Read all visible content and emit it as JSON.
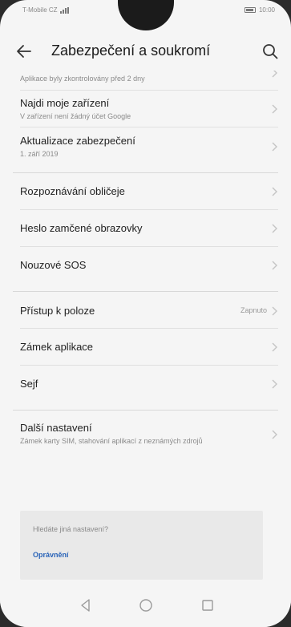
{
  "status_bar": {
    "carrier": "T-Mobile CZ",
    "time": "10:00"
  },
  "header": {
    "title": "Zabezpečení a soukromí"
  },
  "items": [
    {
      "title": "",
      "subtitle": "Aplikace byly zkontrolovány před 2 dny"
    },
    {
      "title": "Najdi moje zařízení",
      "subtitle": "V zařízení není žádný účet Google"
    },
    {
      "title": "Aktualizace zabezpečení",
      "subtitle": "1. září 2019"
    },
    {
      "title": "Rozpoznávání obličeje"
    },
    {
      "title": "Heslo zamčené obrazovky"
    },
    {
      "title": "Nouzové SOS"
    },
    {
      "title": "Přístup k poloze",
      "value": "Zapnuto"
    },
    {
      "title": "Zámek aplikace"
    },
    {
      "title": "Sejf"
    },
    {
      "title": "Další nastavení",
      "subtitle": "Zámek karty SIM, stahování aplikací z neznámých zdrojů"
    }
  ],
  "suggestion": {
    "question": "Hledáte jiná nastavení?",
    "link": "Oprávnění"
  },
  "nav": [
    "back",
    "home",
    "recents"
  ],
  "colors": {
    "background": "#f5f5f5",
    "link": "#2a64b8",
    "suggest_bg": "#e9e9e9"
  }
}
